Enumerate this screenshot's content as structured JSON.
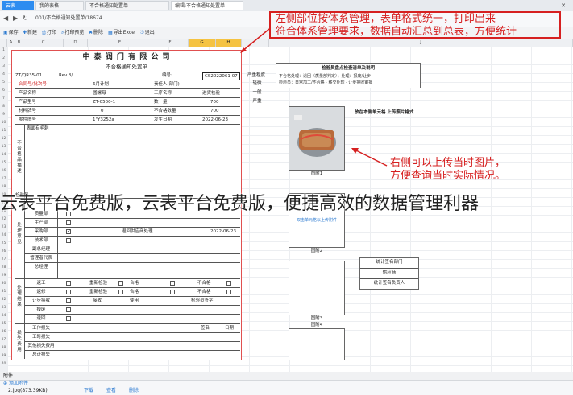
{
  "tabs": [
    {
      "label": "云表"
    },
    {
      "label": "我的表格"
    },
    {
      "label": "不合格通知处置单"
    },
    {
      "label": "编辑:不合格通知处置单"
    }
  ],
  "url": "001/不合格通知处置单/18674",
  "toolbar": [
    "保存",
    "新建",
    "打印",
    "打印预览",
    "删除",
    "导出Excel",
    "退出"
  ],
  "columns": [
    "A",
    "B",
    "C",
    "D",
    "E",
    "F",
    "G",
    "H",
    "I",
    "J"
  ],
  "rows": [
    "1",
    "2",
    "3",
    "4",
    "5",
    "6",
    "7",
    "8",
    "9",
    "10",
    "11",
    "12",
    "13",
    "14",
    "15",
    "16",
    "17",
    "18",
    "19",
    "20",
    "21",
    "22",
    "23",
    "24",
    "25",
    "26",
    "27",
    "28",
    "29",
    "30",
    "31",
    "32",
    "33",
    "34",
    "35",
    "36",
    "37",
    "38",
    "39",
    "40"
  ],
  "form": {
    "company": "中 泰 阀 门 有 限 公 司",
    "title": "不合格通知处置单",
    "doc_no": "ZT/QR35-01",
    "rev": "Rev.B/",
    "number_label": "编号:",
    "number": "CS2022061-07",
    "severity_label": "严重程度",
    "severity_levels": [
      "轻微",
      "一般",
      "严重"
    ],
    "fields": [
      {
        "l": "合同号/批次号",
        "v": "6月计划",
        "l2": "责任人(部门)",
        "v2": ""
      },
      {
        "l": "产品名称",
        "v": "圆螺母",
        "l2": "工序名称",
        "v2": "进货检验"
      },
      {
        "l": "产品型号",
        "v": "ZT-0500-1",
        "l2": "数　量",
        "v2": "700"
      },
      {
        "l": "材料牌号",
        "v": "0",
        "l2": "不合格数量",
        "v2": "700"
      },
      {
        "l": "零件图号",
        "v": "1\"Y3252a",
        "l2": "发生日期",
        "v2": "2022-06-23"
      }
    ],
    "desc_head": "表面有毛刺",
    "sec_desc": "不合格品描述",
    "inspector": "检验员",
    "sec_dispose": "处理意见",
    "dept_rows": [
      "质量部",
      "生产部",
      "采购部",
      "技术部",
      "副总经理",
      "管理者代表",
      "总经理"
    ],
    "purchase_note": "退回供应商处理",
    "purchase_date": "2022-06-23",
    "sec_result": "处理结果",
    "result_rows": [
      {
        "l": "返工",
        "a": "重新检验",
        "b": "合格",
        "c": "不合格"
      },
      {
        "l": "返修",
        "a": "重新检验",
        "b": "合格",
        "c": "不合格"
      },
      {
        "l": "让步接收",
        "a": "接收",
        "b": "使用",
        "c": "检验员签字"
      },
      {
        "l": "报废",
        "a": "",
        "b": "",
        "c": ""
      },
      {
        "l": "退回",
        "a": "",
        "b": "",
        "c": ""
      }
    ],
    "sec_cost": "损失费用",
    "cost_rows": [
      "工作损失",
      "工时损失",
      "其他损失费用",
      "总计损失"
    ],
    "sign_label": "签名",
    "date_label": "日期"
  },
  "panel": {
    "title": "检验员盘点检查清单及说明",
    "note1": "不合格处理：退回（质量部判定）；处理：报废/让步",
    "note2": "检验员：日常加工/不合格 · 移交处理 · 让步接收审批",
    "photo_caption": "放在本侧单元格 上传照片格式",
    "photo_label": "图附1",
    "upload_text": "双击单元格以上传附件",
    "photo2_label": "图附2",
    "photo3_label": "图附3",
    "photo4_label": "图附4",
    "sign_rows": [
      "统计签名部门",
      "供应商",
      "统计签名负责人"
    ]
  },
  "annotations": {
    "top_line1": "左侧部位按体系管理，表单格式统一，打印出来",
    "top_line2": "符合体系管理要求，数据自动汇总到总表，方便统计",
    "right_line1": "右侧可以上传当时图片，",
    "right_line2": "方便查询当时实际情况。"
  },
  "watermark": "云表平台免费版，云表平台免费版，便捷高效的数据管理利器",
  "sheettab": "附件",
  "attach": {
    "header": "添加附件",
    "file": "2.jpg(873.39KB)",
    "actions": [
      "下载",
      "查看",
      "删除"
    ]
  },
  "colors": {
    "annotation": "#d62020",
    "brand": "#2d8cf0",
    "selected_col": "#f5c342"
  }
}
